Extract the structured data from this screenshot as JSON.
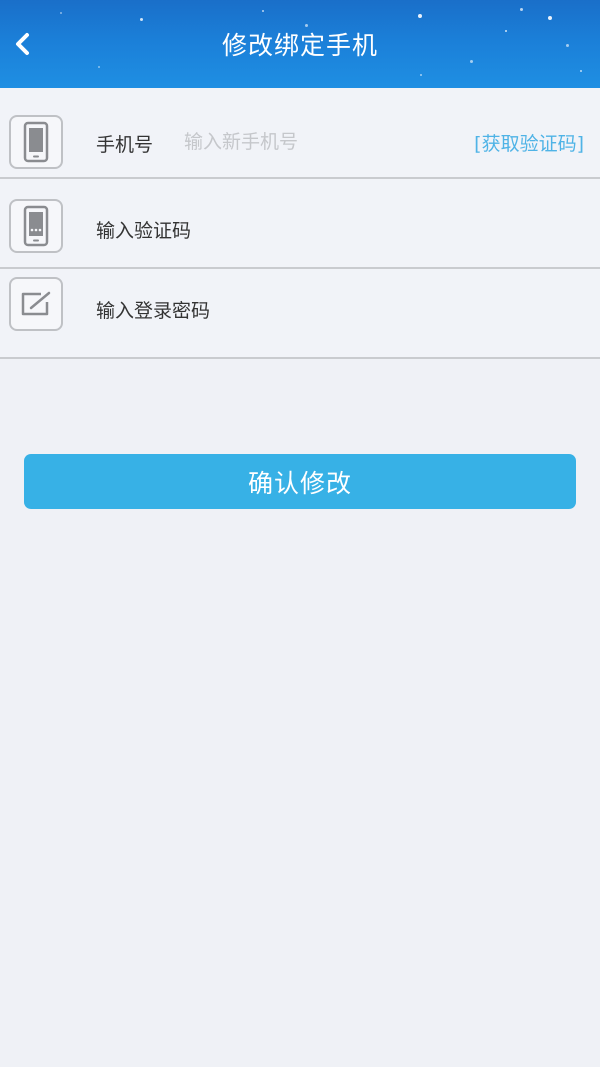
{
  "header": {
    "title": "修改绑定手机",
    "back_icon": "chevron-left-icon"
  },
  "form": {
    "phone_row": {
      "label": "手机号",
      "placeholder": "输入新手机号",
      "value": "",
      "get_code_label": "[获取验证码]",
      "icon": "smartphone-icon"
    },
    "code_row": {
      "label": "输入验证码",
      "icon": "phone-message-icon"
    },
    "password_row": {
      "label": "输入登录密码",
      "icon": "edit-pen-icon"
    }
  },
  "actions": {
    "confirm_label": "确认修改"
  },
  "colors": {
    "header": "#1b7fd8",
    "accent": "#37b1e6",
    "link": "#4fb3e6",
    "background": "#eff1f6"
  }
}
